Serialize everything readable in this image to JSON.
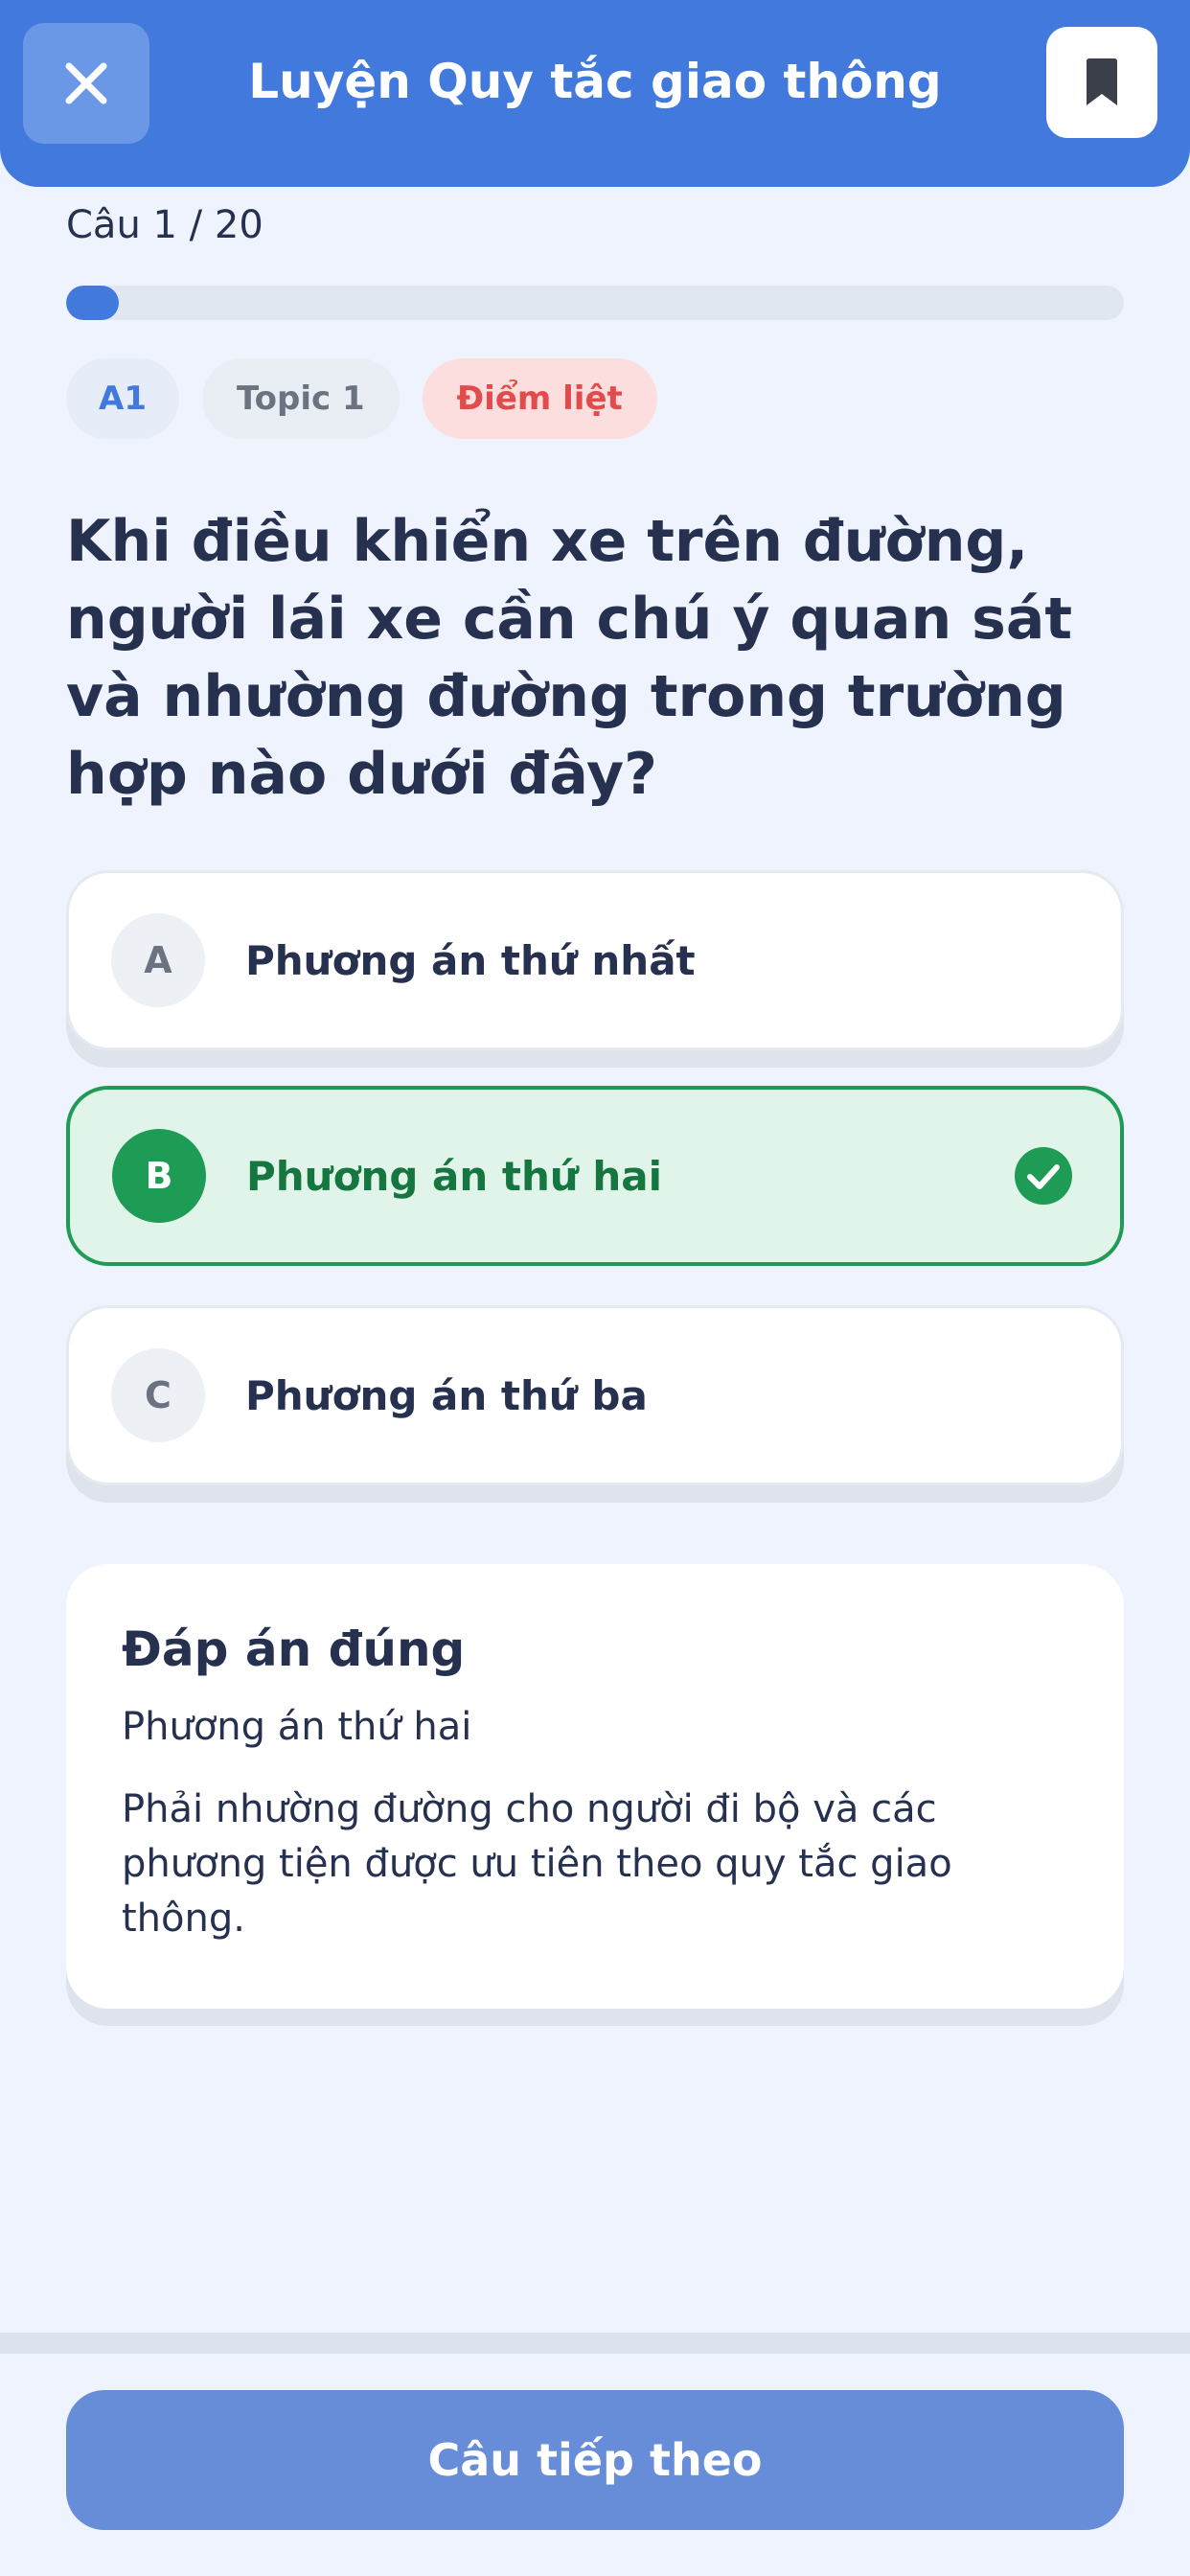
{
  "header": {
    "title": "Luyện Quy tắc giao thông",
    "close_icon": "close-icon",
    "bookmark_icon": "bookmark-icon"
  },
  "progress": {
    "counter": "Câu 1 / 20",
    "current": 1,
    "total": 20,
    "fraction": 0.05
  },
  "tags": {
    "level": "A1",
    "topic": "Topic 1",
    "critical": "Điểm liệt"
  },
  "question": {
    "text": "Khi điều khiển xe trên đường, người lái xe cần chú ý quan sát và nhường đường trong trường hợp nào dưới đây?"
  },
  "options": [
    {
      "letter": "A",
      "text": "Phương án thứ nhất",
      "selected": false
    },
    {
      "letter": "B",
      "text": "Phương án thứ hai",
      "selected": true,
      "correct": true
    },
    {
      "letter": "C",
      "text": "Phương án thứ ba",
      "selected": false
    }
  ],
  "answer": {
    "heading": "Đáp án đúng",
    "value": "Phương án thứ hai",
    "explanation": "Phải nhường đường cho người đi bộ và các phương tiện được ưu tiên theo quy tắc giao thông."
  },
  "footer": {
    "next_label": "Câu tiếp theo"
  },
  "colors": {
    "primary": "#4279dc",
    "correct": "#1e9b55",
    "critical": "#e24b4b"
  }
}
